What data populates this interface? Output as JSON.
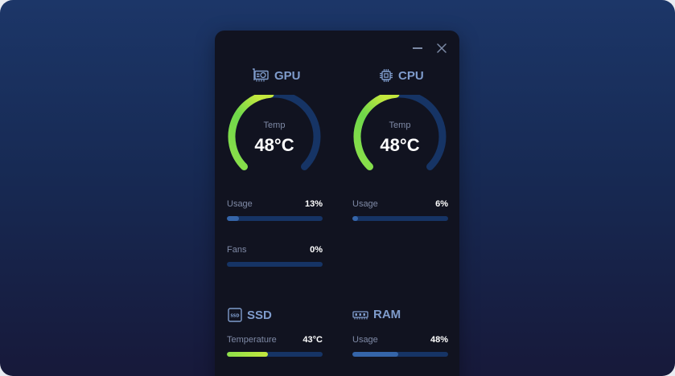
{
  "window": {
    "minimize_icon": "minimize-icon",
    "close_icon": "close-icon"
  },
  "gpu": {
    "title": "GPU",
    "icon": "gpu-card-icon",
    "gauge": {
      "label": "Temp",
      "value": "48°C",
      "level": 0.48
    },
    "usage": {
      "label": "Usage",
      "value": "13%",
      "level": 0.13
    },
    "fans": {
      "label": "Fans",
      "value": "0%",
      "level": 0
    }
  },
  "cpu": {
    "title": "CPU",
    "icon": "cpu-chip-icon",
    "gauge": {
      "label": "Temp",
      "value": "48°C",
      "level": 0.48
    },
    "usage": {
      "label": "Usage",
      "value": "6%",
      "level": 0.06
    }
  },
  "ssd": {
    "title": "SSD",
    "icon": "ssd-icon",
    "temperature": {
      "label": "Temperature",
      "value": "43°C",
      "level": 0.43
    }
  },
  "ram": {
    "title": "RAM",
    "icon": "ram-stick-icon",
    "usage": {
      "label": "Usage",
      "value": "48%",
      "level": 0.48
    }
  },
  "colors": {
    "accent_green": "#8ee04a",
    "accent_green_light": "#c4e83e",
    "track": "#163465",
    "usage_fill": "#3565a9",
    "header_text": "#7f9ccc"
  }
}
